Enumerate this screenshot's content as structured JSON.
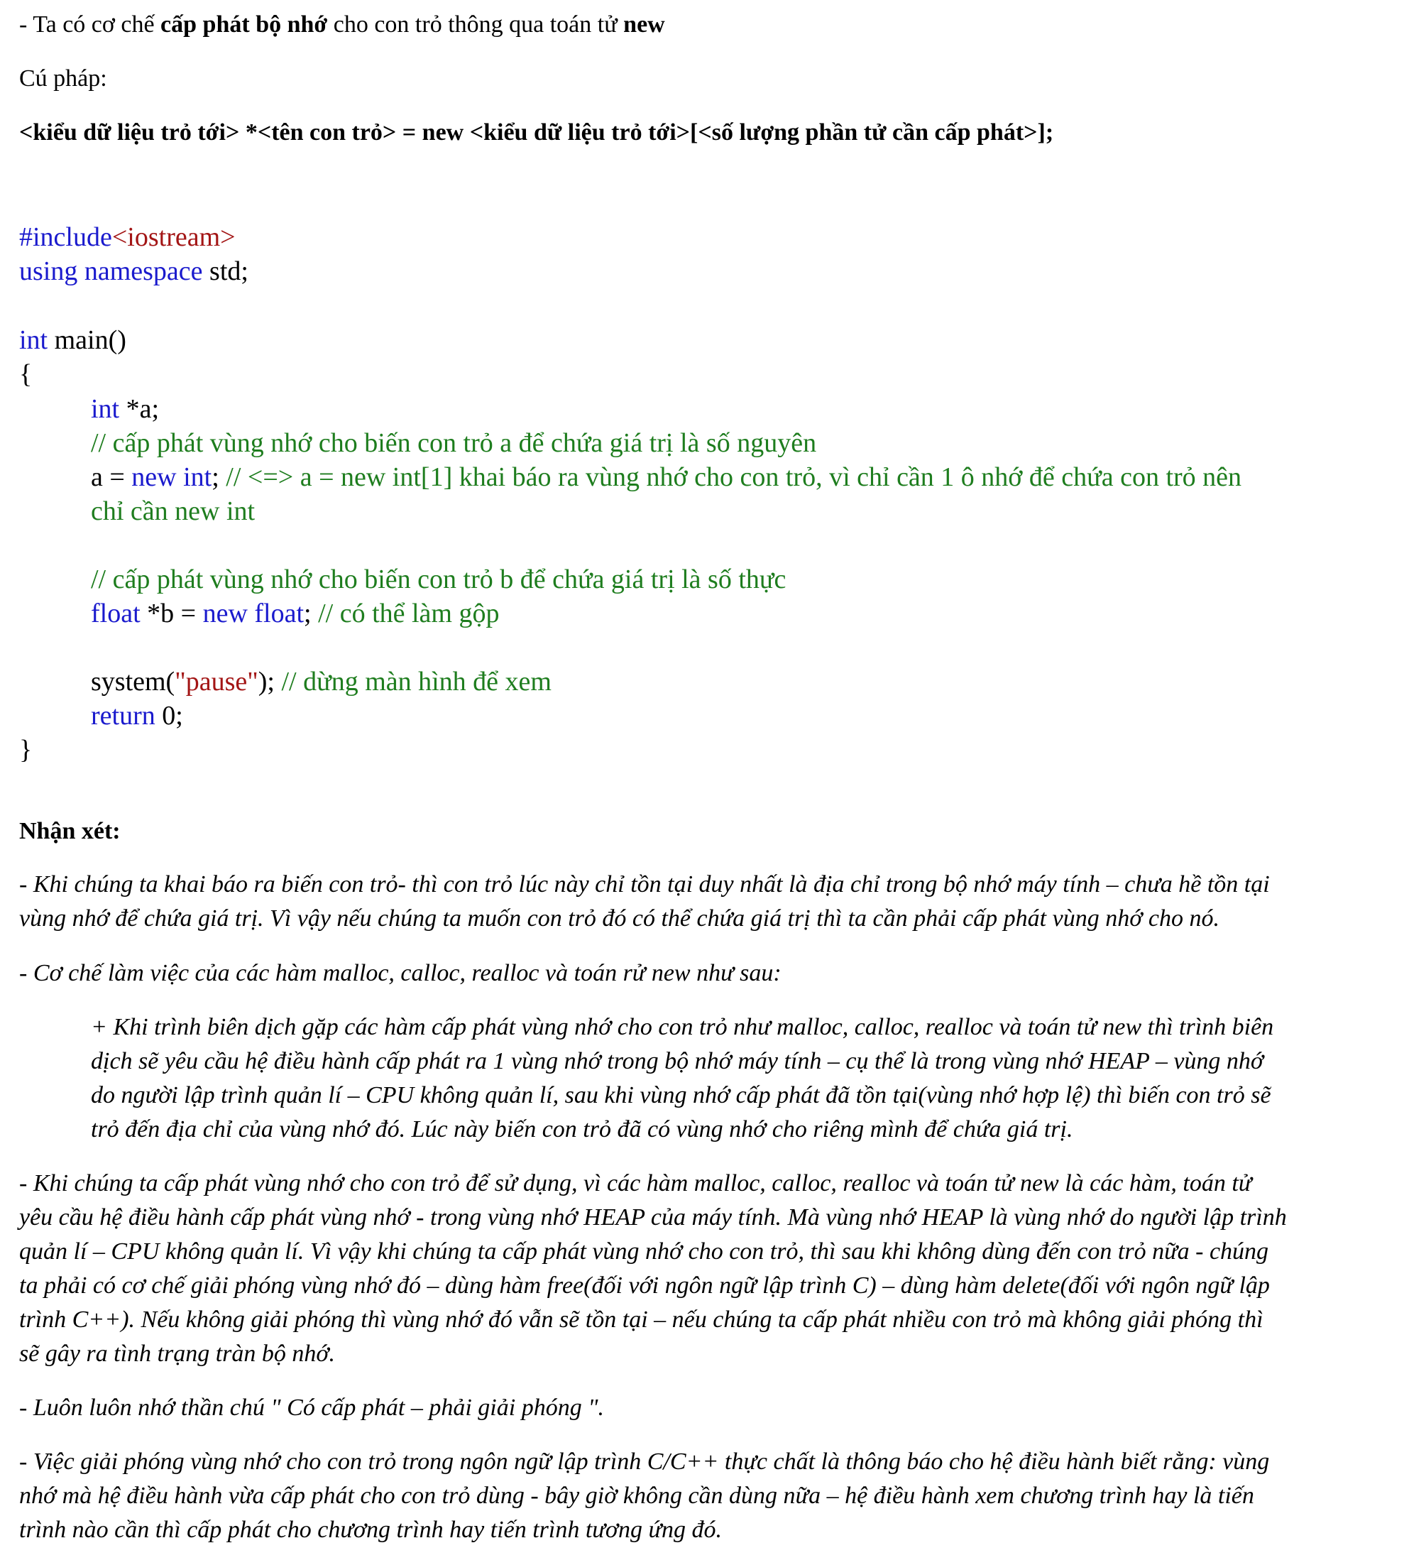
{
  "intro": {
    "prefix": "- Ta có cơ chế ",
    "bold1": "cấp phát bộ nhớ",
    "middle": " cho con trỏ thông qua toán tử ",
    "bold2": "new"
  },
  "syntax_label": "Cú pháp:",
  "syntax": "<kiểu dữ liệu trỏ tới> *<tên con trỏ> = new <kiểu dữ liệu trỏ tới>[<số lượng phần tử cần cấp phát>];",
  "code": {
    "l1_kw": "#include",
    "l1_str": "<iostream>",
    "l2_kw": "using namespace",
    "l2_rest": " std;",
    "l3_kw": "int",
    "l3_rest": " main()",
    "l4": "{",
    "l5_kw": "int",
    "l5_rest": " *a;",
    "l6_cm": "// cấp phát vùng nhớ cho biến con trỏ a để chứa giá trị là số nguyên",
    "l7_a": "a = ",
    "l7_kw": "new int",
    "l7_semi": ";",
    "l7_cm": " // <=> a = new int[1] khai báo ra vùng nhớ cho con trỏ, vì chỉ cần 1 ô nhớ để chứa con trỏ nên",
    "l8_cm": "chỉ cần new int",
    "l9_cm": "// cấp phát vùng nhớ cho biến con trỏ b để chứa giá trị là số thực",
    "l10_kw1": "float",
    "l10_mid": " *b = ",
    "l10_kw2": "new float",
    "l10_semi": ";",
    "l10_cm": " // có thể làm gộp",
    "l11_a": "system(",
    "l11_str": "\"pause\"",
    "l11_b": ");",
    "l11_cm": " // dừng màn hình để xem",
    "l12_kw": "return",
    "l12_rest": " 0;",
    "l13": "}"
  },
  "remark_label": "Nhận xét:",
  "remarks": [
    "- Khi chúng ta khai báo ra biến con trỏ-  thì con trỏ lúc này chỉ tồn tại duy nhất là địa chỉ trong bộ nhớ máy tính – chưa hề tồn tại",
    "vùng nhớ để chứa giá trị. Vì vậy nếu chúng ta muốn con trỏ đó có thể chứa giá trị thì ta cần phải cấp phát vùng nhớ cho nó.",
    "- Cơ chế làm việc của các hàm malloc, calloc, realloc và toán rử new như sau:",
    "+ Khi trình biên dịch gặp các hàm cấp phát vùng nhớ cho con trỏ như malloc, calloc, realloc và toán tử new thì trình biên",
    "dịch sẽ yêu cầu hệ điều hành cấp phát ra 1 vùng nhớ trong bộ nhớ máy tính – cụ thể là trong vùng nhớ HEAP – vùng nhớ",
    "do người lập trình quản lí – CPU không quản lí, sau khi vùng nhớ cấp phát đã tồn tại(vùng nhớ hợp lệ) thì biến con trỏ sẽ",
    "trỏ đến địa chỉ của vùng nhớ đó. Lúc này biến con trỏ đã có vùng nhớ cho riêng mình để chứa giá trị.",
    "- Khi chúng ta cấp phát vùng nhớ cho con trỏ để sử dụng, vì các hàm malloc, calloc, realloc và toán tử new là các hàm, toán tử",
    "yêu cầu hệ điều hành cấp phát vùng nhớ - trong vùng nhớ HEAP của máy tính. Mà vùng nhớ HEAP là vùng nhớ do người lập trình",
    "quản lí – CPU không quản lí. Vì vậy khi chúng ta cấp phát vùng nhớ cho con trỏ,  thì sau khi không dùng đến con trỏ nữa - chúng",
    "ta phải có cơ chế giải phóng vùng nhớ đó – dùng hàm free(đối với ngôn ngữ lập trình C) – dùng hàm delete(đối với ngôn ngữ lập",
    "trình C++). Nếu không giải phóng thì vùng nhớ đó vẫn sẽ tồn tại – nếu chúng ta cấp phát nhiều con trỏ mà không giải phóng thì",
    "sẽ gây ra tình trạng tràn bộ nhớ.",
    "-  Luôn luôn nhớ thần chú   \" Có cấp phát – phải giải phóng  \".",
    "- Việc giải phóng vùng nhớ cho con trỏ trong ngôn ngữ lập trình C/C++ thực chất là thông báo cho hệ điều hành biết rằng: vùng",
    "nhớ mà hệ điều hành vừa cấp phát cho con trỏ dùng - bây giờ không cần dùng nữa – hệ điều hành xem chương trình hay là tiến",
    "trình nào cần thì cấp phát cho chương trình hay tiến trình tương ứng đó."
  ]
}
